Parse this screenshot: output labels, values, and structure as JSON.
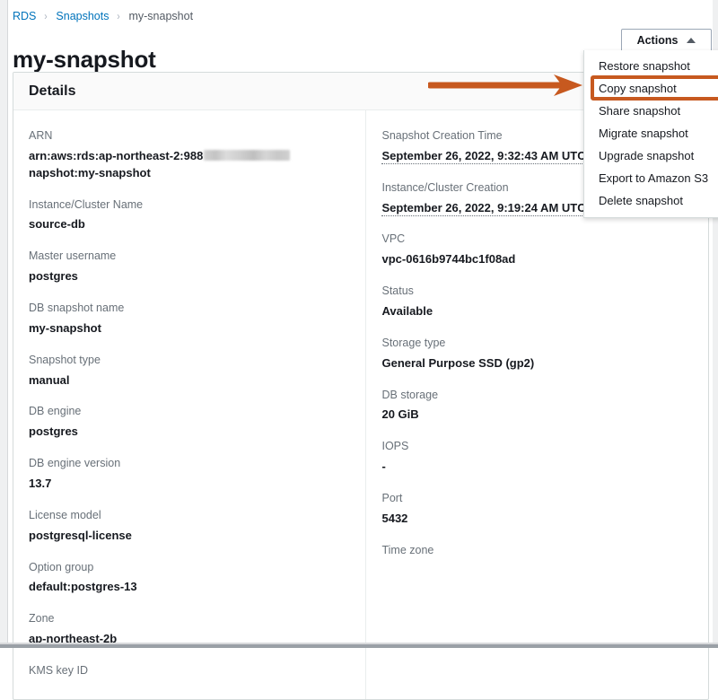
{
  "breadcrumb": {
    "items": [
      {
        "label": "RDS",
        "link": true
      },
      {
        "label": "Snapshots",
        "link": true
      },
      {
        "label": "my-snapshot",
        "link": false
      }
    ],
    "separator": "›"
  },
  "page": {
    "title": "my-snapshot"
  },
  "toolbar": {
    "actions_label": "Actions"
  },
  "actions_menu": {
    "items": [
      {
        "label": "Restore snapshot",
        "highlighted": false
      },
      {
        "label": "Copy snapshot",
        "highlighted": true
      },
      {
        "label": "Share snapshot",
        "highlighted": false
      },
      {
        "label": "Migrate snapshot",
        "highlighted": false
      },
      {
        "label": "Upgrade snapshot",
        "highlighted": false
      },
      {
        "label": "Export to Amazon S3",
        "highlighted": false
      },
      {
        "label": "Delete snapshot",
        "highlighted": false
      }
    ]
  },
  "annotation": {
    "color": "#c7591f",
    "target": "Copy snapshot"
  },
  "details": {
    "header": "Details",
    "left_column": [
      {
        "label": "ARN",
        "value": "arn:aws:rds:ap-northeast-2:988",
        "value_suffix": "napshot:my-snapshot",
        "redacted": true
      },
      {
        "label": "Instance/Cluster Name",
        "value": "source-db"
      },
      {
        "label": "Master username",
        "value": "postgres"
      },
      {
        "label": "DB snapshot name",
        "value": "my-snapshot"
      },
      {
        "label": "Snapshot type",
        "value": "manual"
      },
      {
        "label": "DB engine",
        "value": "postgres"
      },
      {
        "label": "DB engine version",
        "value": "13.7"
      },
      {
        "label": "License model",
        "value": "postgresql-license"
      },
      {
        "label": "Option group",
        "value": "default:postgres-13"
      },
      {
        "label": "Zone",
        "value": "ap-northeast-2b"
      },
      {
        "label": "KMS key ID",
        "value": ""
      }
    ],
    "right_column": [
      {
        "label": "Snapshot Creation Time",
        "value": "September 26, 2022, 9:32:43 AM UTC",
        "dotted": true
      },
      {
        "label": "Instance/Cluster Creation",
        "value": "September 26, 2022, 9:19:24 AM UTC",
        "dotted": true
      },
      {
        "label": "VPC",
        "value": "vpc-0616b9744bc1f08ad"
      },
      {
        "label": "Status",
        "value": "Available"
      },
      {
        "label": "Storage type",
        "value": "General Purpose SSD (gp2)"
      },
      {
        "label": "DB storage",
        "value": "20 GiB"
      },
      {
        "label": "IOPS",
        "value": "-"
      },
      {
        "label": "Port",
        "value": "5432"
      },
      {
        "label": "Time zone",
        "value": ""
      }
    ]
  },
  "colors": {
    "link": "#0073bb",
    "accent_orange": "#c7591f",
    "text_primary": "#16191f",
    "text_secondary": "#687078"
  }
}
